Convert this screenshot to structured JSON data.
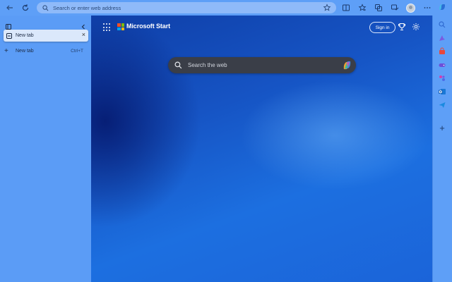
{
  "toolbar": {
    "address_placeholder": "Search or enter web address"
  },
  "sidebar": {
    "active_tab_label": "New tab",
    "new_tab_label": "New tab",
    "new_tab_shortcut": "Ctrl+T"
  },
  "page": {
    "brand": "Microsoft Start",
    "signin_label": "Sign in",
    "search_placeholder": "Search the web"
  },
  "icons": {
    "toolbar": [
      "back-icon",
      "refresh-icon",
      "search-icon",
      "favorite-star-icon",
      "split-screen-icon",
      "favorites-icon",
      "collections-icon",
      "browser-essentials-icon",
      "profile-avatar",
      "more-icon"
    ],
    "rail": [
      "copilot-icon",
      "search-icon",
      "discover-icon",
      "shopping-icon",
      "games-icon",
      "tools-icon",
      "outlook-icon",
      "send-icon",
      "add-icon"
    ]
  },
  "colors": {
    "toolbar": "#5e9ff7",
    "page_dark": "#0f3fa8",
    "page_light": "#1c6fe0",
    "search_bg": "#3a3e48"
  }
}
